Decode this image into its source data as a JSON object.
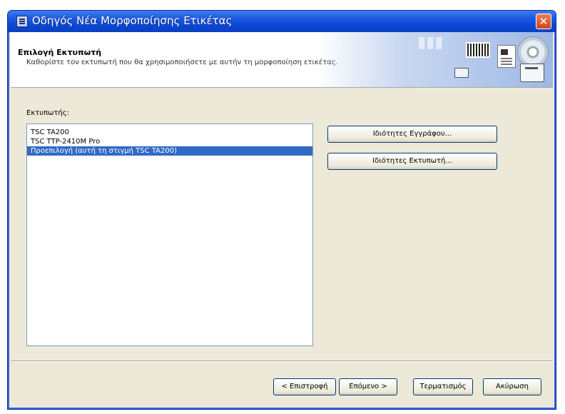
{
  "window": {
    "title": "Οδηγός Νέα Μορφοποίησης Ετικέτας",
    "close_glyph": "✕"
  },
  "header": {
    "title": "Επιλογή Εκτυπωτή",
    "subtitle": "Καθορίστε τον εκτυπωτή που θα χρησιμοποιήσετε με αυτήν τη μορφοποίηση ετικέτας."
  },
  "printers": {
    "label": "Εκτυπωτής:",
    "items": [
      {
        "label": "TSC TA200",
        "selected": false
      },
      {
        "label": "TSC TTP-2410M Pro",
        "selected": false
      },
      {
        "label": "Προεπιλογή (αυτή τη στιγμή TSC TA200)",
        "selected": true
      }
    ]
  },
  "buttons": {
    "document_properties": "Ιδιότητες Εγγράφου...",
    "printer_properties": "Ιδιότητες Εκτυπωτή...",
    "back": "< Επιστροφή",
    "next": "Επόμενο >",
    "finish": "Τερματισμός",
    "cancel": "Ακύρωση"
  },
  "icons": [
    "app-icon",
    "close-icon",
    "barcode-icon",
    "document-icon",
    "printer-icon",
    "cd-icon"
  ],
  "colors": {
    "titlebar": "#0b46d4",
    "selection": "#316ac5",
    "dialog_bg": "#ece9d8"
  }
}
